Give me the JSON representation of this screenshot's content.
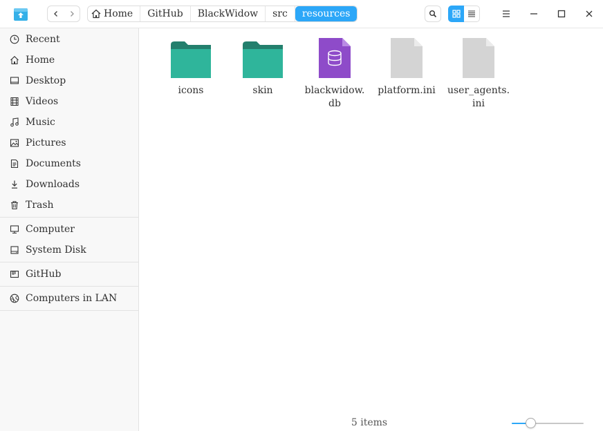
{
  "titlebar": {
    "app_icon": "file-manager-icon",
    "back_icon": "‹",
    "forward_icon": "›",
    "breadcrumbs": [
      "Home",
      "GitHub",
      "BlackWidow",
      "src",
      "resources"
    ],
    "active_breadcrumb": "resources",
    "accent_color": "#2ca7f8"
  },
  "sidebar": {
    "items": [
      {
        "label": "Recent",
        "icon": "clock-icon"
      },
      {
        "label": "Home",
        "icon": "home-icon"
      },
      {
        "label": "Desktop",
        "icon": "desktop-icon"
      },
      {
        "label": "Videos",
        "icon": "film-icon"
      },
      {
        "label": "Music",
        "icon": "music-note-icon"
      },
      {
        "label": "Pictures",
        "icon": "picture-icon"
      },
      {
        "label": "Documents",
        "icon": "document-icon"
      },
      {
        "label": "Downloads",
        "icon": "download-icon"
      },
      {
        "label": "Trash",
        "icon": "trash-icon"
      },
      {
        "label": "Computer",
        "icon": "computer-icon"
      },
      {
        "label": "System Disk",
        "icon": "disk-icon"
      },
      {
        "label": "GitHub",
        "icon": "drive-icon"
      },
      {
        "label": "Computers in LAN",
        "icon": "network-icon"
      }
    ]
  },
  "files": [
    {
      "name": "icons",
      "type": "folder",
      "color": "#2fb59b"
    },
    {
      "name": "skin",
      "type": "folder",
      "color": "#2fb59b"
    },
    {
      "name": "blackwidow.db",
      "type": "database",
      "color": "#8e4bc9"
    },
    {
      "name": "platform.ini",
      "type": "text",
      "color": "#d4d4d4"
    },
    {
      "name": "user_agents.ini",
      "type": "text",
      "color": "#d4d4d4"
    }
  ],
  "status": {
    "item_count": "5 items",
    "zoom_level_fraction": 0.26
  }
}
